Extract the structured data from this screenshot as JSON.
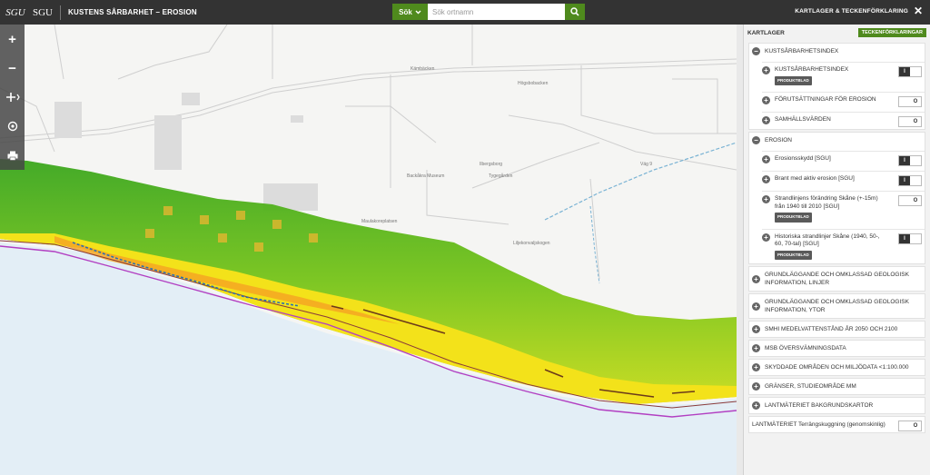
{
  "header": {
    "logo": "SGU",
    "brand": "SGU",
    "title": "KUSTENS SÅRBARHET – EROSION",
    "search_button": "Sök",
    "search_placeholder": "Sök ortnamn",
    "right_title": "KARTLAGER & TECKENFÖRKLARING"
  },
  "toolbar": {
    "items": [
      "zoom-in",
      "zoom-out",
      "pan",
      "locate",
      "print"
    ]
  },
  "map": {
    "labels": [
      "Kämbäcken",
      "Högsbobacken",
      "Ilbergsborg",
      "Tygegården",
      "Backåkra Museum",
      "Maulakoreplatsen",
      "Liljekonvaljskogen",
      "Väg 9"
    ]
  },
  "panel": {
    "title": "KARTLAGER",
    "legend_button": "TECKENFÖRKLARINGAR",
    "badge": "PRODUKTBLAD",
    "groups": [
      {
        "label": "KUSTSÅRBARHETSINDEX",
        "expanded": true,
        "layers": [
          {
            "label": "KUSTSÅRBARHETSINDEX",
            "on": true,
            "badge": true
          },
          {
            "label": "FÖRUTSÄTTNINGAR FÖR EROSION",
            "on": false,
            "badge": false
          },
          {
            "label": "SAMHÄLLSVÄRDEN",
            "on": false,
            "badge": false
          }
        ]
      },
      {
        "label": "EROSION",
        "expanded": true,
        "layers": [
          {
            "label": "Erosionsskydd [SGU]",
            "on": true,
            "badge": false
          },
          {
            "label": "Brant med aktiv erosion [SGU]",
            "on": true,
            "badge": false
          },
          {
            "label": "Strandlinjens förändring Skåne (+-15m) från 1940 till 2010 [SGU]",
            "on": false,
            "badge": true
          },
          {
            "label": "Historiska strandlinjer Skåne (1940, 50-, 60, 70-tal) [SGU]",
            "on": true,
            "badge": true
          }
        ]
      },
      {
        "label": "GRUNDLÄGGANDE OCH OMKLASSAD GEOLOGISK INFORMATION, LINJER",
        "expanded": false
      },
      {
        "label": "GRUNDLÄGGANDE OCH OMKLASSAD GEOLOGISK INFORMATION, YTOR",
        "expanded": false
      },
      {
        "label": "SMHI MEDELVATTENSTÅND ÅR 2050 OCH 2100",
        "expanded": false
      },
      {
        "label": "MSB ÖVERSVÄMNINGSDATA",
        "expanded": false
      },
      {
        "label": "SKYDDADE OMRÅDEN OCH MILJÖDATA <1:100.000",
        "expanded": false
      },
      {
        "label": "GRÄNSER, STUDIEOMRÅDE MM",
        "expanded": false
      },
      {
        "label": "LANTMÄTERIET BAKGRUNDSKARTOR",
        "expanded": false
      }
    ],
    "bottom_layer": {
      "label": "LANTMÄTERIET Terrängskuggning (genomskinlig)",
      "on": false
    },
    "toggle_on": "I",
    "toggle_off": "O"
  }
}
